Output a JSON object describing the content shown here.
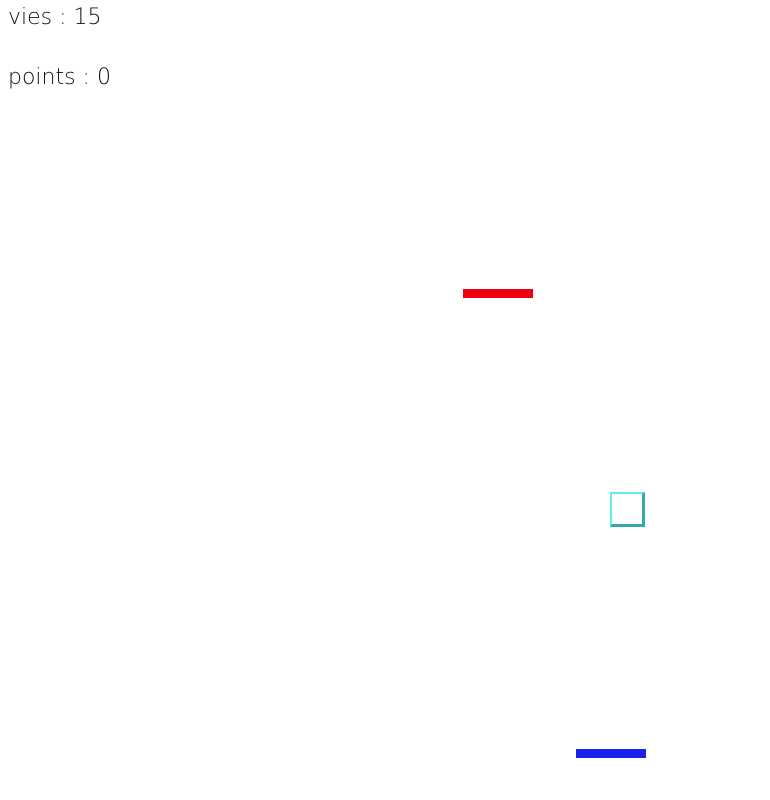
{
  "hud": {
    "lives_text": "vies : 15",
    "points_text": "points : 0"
  },
  "colors": {
    "enemy_paddle": "#ee0011",
    "player_paddle": "#1a22ee",
    "ball_border_light": "#66eeee",
    "ball_border_dark": "#33aaaa"
  }
}
